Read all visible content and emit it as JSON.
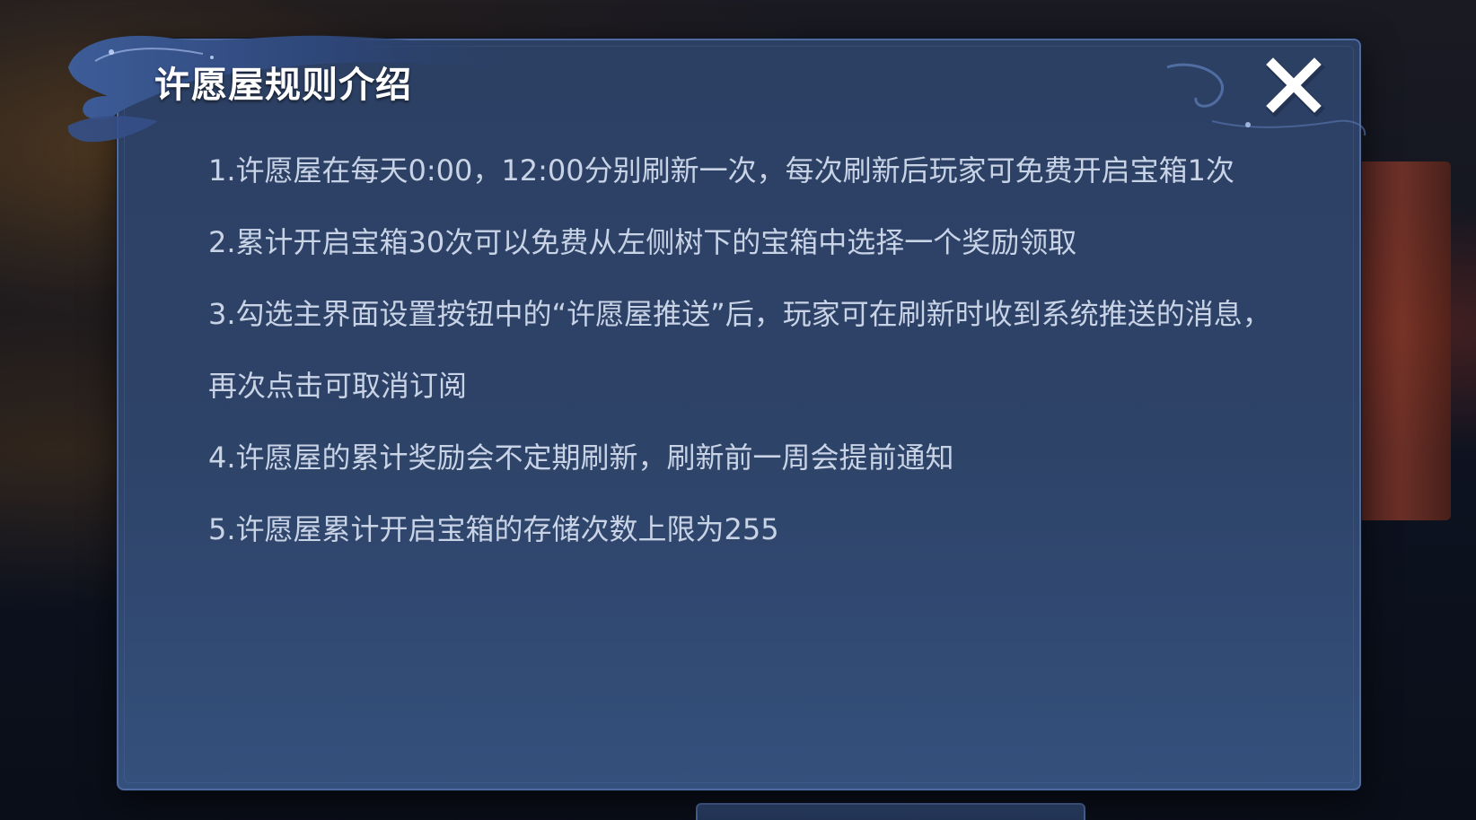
{
  "dialog": {
    "title": "许愿屋规则介绍",
    "close_icon": "close-icon",
    "rules": [
      "1.许愿屋在每天0:00，12:00分别刷新一次，每次刷新后玩家可免费开启宝箱1次",
      "2.累计开启宝箱30次可以免费从左侧树下的宝箱中选择一个奖励领取",
      "3.勾选主界面设置按钮中的“许愿屋推送”后，玩家可在刷新时收到系统推送的消息，再次点击可取消订阅",
      "4.许愿屋的累计奖励会不定期刷新，刷新前一周会提前通知",
      "5.许愿屋累计开启宝箱的存储次数上限为255"
    ]
  },
  "colors": {
    "panel_top": "#2c4064",
    "panel_bottom": "#34507c",
    "panel_border": "#4f6a9e",
    "title_text": "#ffffff",
    "rule_text": "#c9d3e6"
  }
}
